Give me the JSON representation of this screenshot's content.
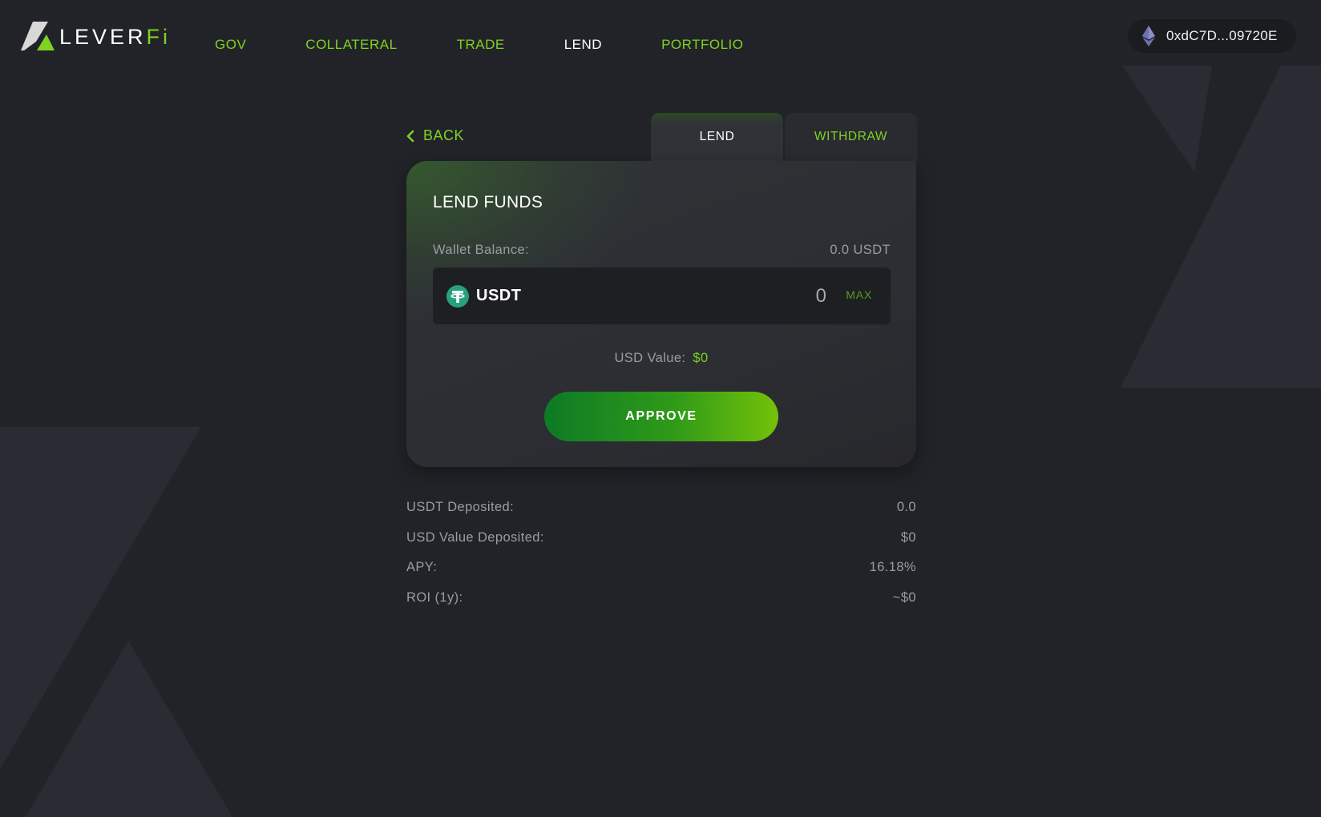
{
  "colors": {
    "accent": "#7ed321",
    "background": "#222328",
    "card": "#2e3035",
    "input_bg": "#1e1f23",
    "muted_text": "#9a9ca3",
    "tether": "#26a17b"
  },
  "brand": {
    "logo_text_main": "LEVER",
    "logo_text_accent": "Fi",
    "logo_icon": "leverfi-logo-icon"
  },
  "nav": {
    "items": [
      {
        "label": "GOV",
        "active": false
      },
      {
        "label": "COLLATERAL",
        "active": false
      },
      {
        "label": "TRADE",
        "active": false
      },
      {
        "label": "LEND",
        "active": true
      },
      {
        "label": "PORTFOLIO",
        "active": false
      }
    ]
  },
  "wallet": {
    "icon": "ethereum-icon",
    "address": "0xdC7D...09720E"
  },
  "back": {
    "icon": "chevron-left-icon",
    "label": "BACK"
  },
  "tabs": [
    {
      "label": "LEND",
      "active": true
    },
    {
      "label": "WITHDRAW",
      "active": false
    }
  ],
  "card": {
    "title": "LEND FUNDS",
    "wallet_balance_label": "Wallet Balance:",
    "wallet_balance_value": "0.0 USDT",
    "token": {
      "icon": "tether-icon",
      "symbol": "USDT"
    },
    "amount_placeholder": "0",
    "max_label": "MAX",
    "usd_value_label": "USD Value:",
    "usd_value": "$0",
    "approve_label": "APPROVE"
  },
  "stats": [
    {
      "label": "USDT Deposited:",
      "value": "0.0"
    },
    {
      "label": "USD Value Deposited:",
      "value": "$0"
    },
    {
      "label": "APY:",
      "value": "16.18%"
    },
    {
      "label": "ROI (1y):",
      "value": "~$0"
    }
  ]
}
